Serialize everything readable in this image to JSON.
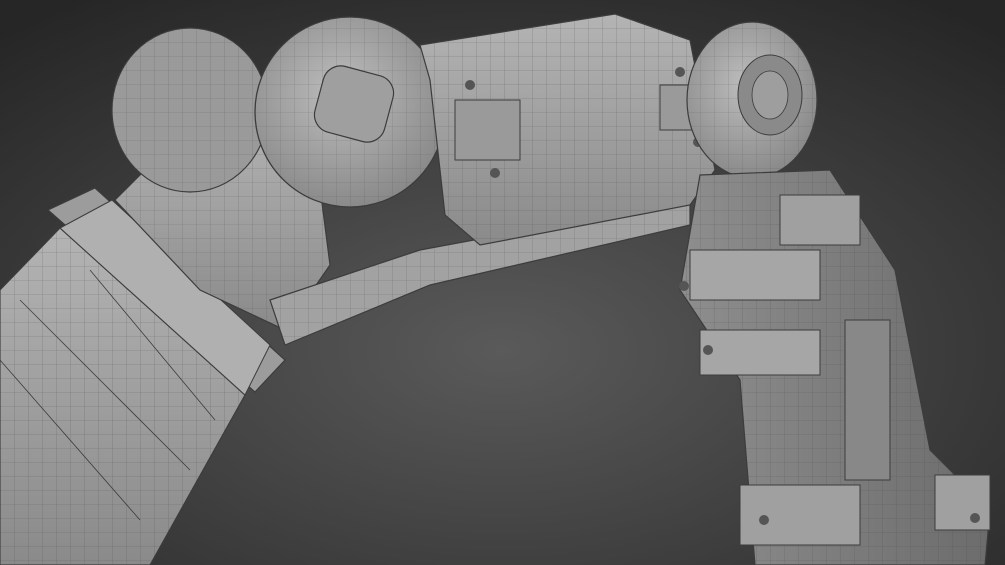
{
  "scene": {
    "subject": "robotic-arm-wireframe-render",
    "colors": {
      "background_center": "#5a5a5a",
      "background_edge": "#262626",
      "mesh_fill_light": "#a8a8a8",
      "mesh_fill_mid": "#8f8f8f",
      "mesh_fill_dark": "#707070",
      "wire": "#3c3c3c"
    }
  }
}
